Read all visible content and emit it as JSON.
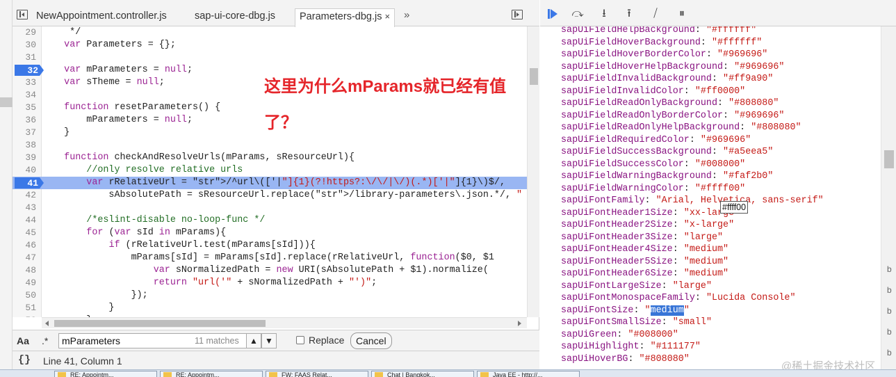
{
  "editor": {
    "tabs": [
      {
        "label": "NewAppointment.controller.js"
      },
      {
        "label": "sap-ui-core-dbg.js"
      },
      {
        "label": "Parameters-dbg.js",
        "close": "×"
      }
    ],
    "more_tabs": "»",
    "lines": [
      {
        "n": "29",
        "text": "     */"
      },
      {
        "n": "30",
        "text": "    var Parameters = {};"
      },
      {
        "n": "31",
        "text": ""
      },
      {
        "n": "32",
        "text": "    var mParameters = null;",
        "breakpoint": true
      },
      {
        "n": "33",
        "text": "    var sTheme = null;"
      },
      {
        "n": "34",
        "text": ""
      },
      {
        "n": "35",
        "text": "    function resetParameters() {"
      },
      {
        "n": "36",
        "text": "        mParameters = null;"
      },
      {
        "n": "37",
        "text": "    }"
      },
      {
        "n": "38",
        "text": ""
      },
      {
        "n": "39",
        "text": "    function checkAndResolveUrls(mParams, sResourceUrl){"
      },
      {
        "n": "40",
        "text": "        //only resolve relative urls"
      },
      {
        "n": "41",
        "text": "        var rRelativeUrl = /^url\\(['|\"]{1}(?!https?:\\/\\/|\\/)(.*)['|\"]{1}\\)$/,",
        "breakpoint": true,
        "current": true
      },
      {
        "n": "42",
        "text": "            sAbsolutePath = sResourceUrl.replace(/library-parameters\\.json.*/, \""
      },
      {
        "n": "43",
        "text": ""
      },
      {
        "n": "44",
        "text": "        /*eslint-disable no-loop-func */"
      },
      {
        "n": "45",
        "text": "        for (var sId in mParams){"
      },
      {
        "n": "46",
        "text": "            if (rRelativeUrl.test(mParams[sId])){"
      },
      {
        "n": "47",
        "text": "                mParams[sId] = mParams[sId].replace(rRelativeUrl, function($0, $1"
      },
      {
        "n": "48",
        "text": "                    var sNormalizedPath = new URI(sAbsolutePath + $1).normalize("
      },
      {
        "n": "49",
        "text": "                    return \"url('\" + sNormalizedPath + \"')\";"
      },
      {
        "n": "50",
        "text": "                });"
      },
      {
        "n": "51",
        "text": "            }"
      },
      {
        "n": "52",
        "text": "        }"
      }
    ]
  },
  "search": {
    "case_label": "Aa",
    "regex_label": ".*",
    "value": "mParameters",
    "match_count": "11 matches",
    "prev_glyph": "▲",
    "next_glyph": "▼",
    "replace_label": "Replace",
    "cancel_label": "Cancel"
  },
  "status": {
    "pretty_print": "{}",
    "cursor": "Line 41, Column 1"
  },
  "annotation": {
    "line1": "这里为什么mParams就已经有值",
    "line2": "了？"
  },
  "debugger": {
    "icons": [
      "resume-icon",
      "step-over-icon",
      "step-into-icon",
      "step-out-icon",
      "deactivate-breakpoints-icon",
      "pause-on-exceptions-icon"
    ],
    "step_over_glyph": "⤼",
    "step_into_glyph": "⭳",
    "step_out_glyph": "⭱",
    "deactivate_glyph": "⧸",
    "pause_glyph": "⏸"
  },
  "properties": [
    {
      "key": "sapUiFieldHelpBackground",
      "value": "\"#ffffff\""
    },
    {
      "key": "sapUiFieldHoverBackground",
      "value": "\"#ffffff\""
    },
    {
      "key": "sapUiFieldHoverBorderColor",
      "value": "\"#969696\""
    },
    {
      "key": "sapUiFieldHoverHelpBackground",
      "value": "\"#969696\""
    },
    {
      "key": "sapUiFieldInvalidBackground",
      "value": "\"#ff9a90\""
    },
    {
      "key": "sapUiFieldInvalidColor",
      "value": "\"#ff0000\""
    },
    {
      "key": "sapUiFieldReadOnlyBackground",
      "value": "\"#808080\""
    },
    {
      "key": "sapUiFieldReadOnlyBorderColor",
      "value": "\"#969696\""
    },
    {
      "key": "sapUiFieldReadOnlyHelpBackground",
      "value": "\"#808080\""
    },
    {
      "key": "sapUiFieldRequiredColor",
      "value": "\"#969696\""
    },
    {
      "key": "sapUiFieldSuccessBackground",
      "value": "\"#a5eea5\""
    },
    {
      "key": "sapUiFieldSuccessColor",
      "value": "\"#008000\""
    },
    {
      "key": "sapUiFieldWarningBackground",
      "value": "\"#faf2b0\""
    },
    {
      "key": "sapUiFieldWarningColor",
      "value": "\"#ffff00\""
    },
    {
      "key": "sapUiFontFamily",
      "value": "\"Arial, Helvetica, sans-serif\""
    },
    {
      "key": "sapUiFontHeader1Size",
      "value": "\"xx-large\""
    },
    {
      "key": "sapUiFontHeader2Size",
      "value": "\"x-large\""
    },
    {
      "key": "sapUiFontHeader3Size",
      "value": "\"large\""
    },
    {
      "key": "sapUiFontHeader4Size",
      "value": "\"medium\""
    },
    {
      "key": "sapUiFontHeader5Size",
      "value": "\"medium\""
    },
    {
      "key": "sapUiFontHeader6Size",
      "value": "\"medium\""
    },
    {
      "key": "sapUiFontLargeSize",
      "value": "\"large\""
    },
    {
      "key": "sapUiFontMonospaceFamily",
      "value": "\"Lucida Console\""
    },
    {
      "key": "sapUiFontSize",
      "value": "\"medium\"",
      "selected": "medium"
    },
    {
      "key": "sapUiFontSmallSize",
      "value": "\"small\""
    },
    {
      "key": "sapUiGreen",
      "value": "\"#008000\""
    },
    {
      "key": "sapUiHighlight",
      "value": "\"#111177\""
    },
    {
      "key": "sapUiHoverBG",
      "value": "\"#808080\""
    }
  ],
  "tooltip": "#ffff00",
  "right_gutter_letters": [
    "b",
    "b",
    "b",
    "b",
    "b",
    "b"
  ],
  "watermark": "@稀土掘金技术社区",
  "taskbar": [
    "RE: Appointm...",
    "RE: Appointm...",
    "FW: FAAS Relat...",
    "Chat | Bangkok...",
    "Java EE - http://..."
  ],
  "colors": {
    "breakpoint": "#3b78e7",
    "current_line": "#99b6f3",
    "annotation": "#e5252a",
    "keyword": "#9b2393",
    "string": "#c41a16",
    "comment": "#236e25",
    "prop_key": "#881280"
  }
}
